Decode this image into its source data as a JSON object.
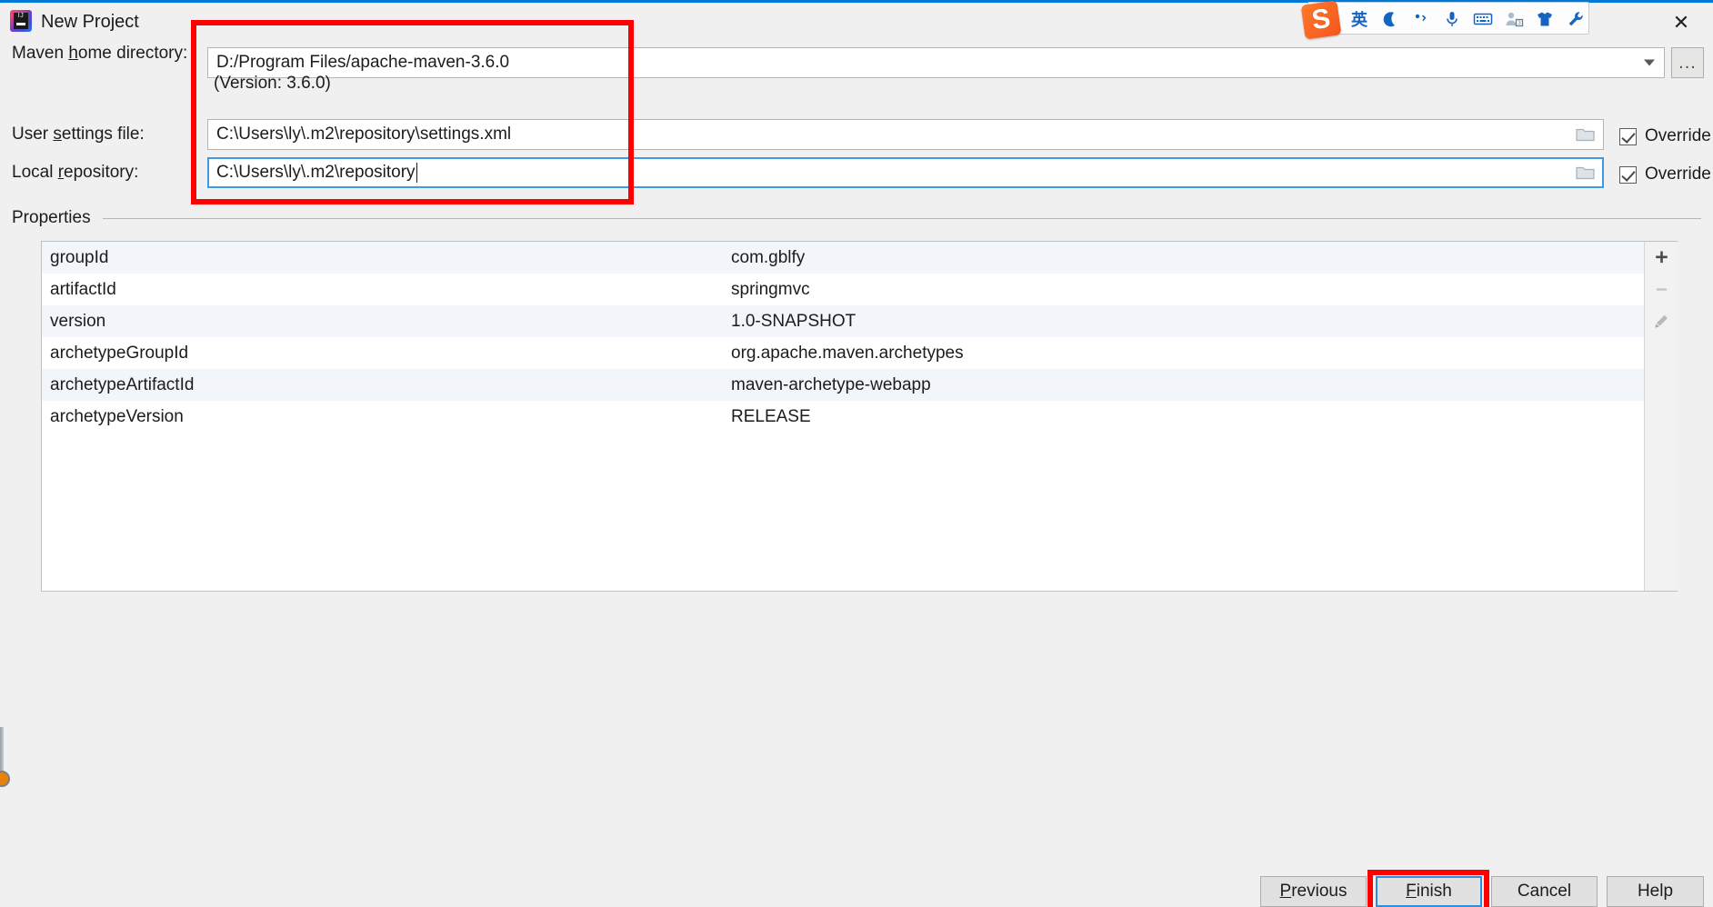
{
  "window": {
    "title": "New Project",
    "logo_icon": "intellij-idea-logo",
    "close_icon": "close-icon",
    "accent_color": "#0078d7"
  },
  "ime_toolbar": {
    "logo": "S",
    "logo_name": "sogou-logo-icon",
    "items": [
      {
        "name": "language-mode-icon",
        "glyph": "英"
      },
      {
        "name": "moon-mode-icon",
        "glyph": "moon"
      },
      {
        "name": "punctuation-mode-icon",
        "glyph": "comma"
      },
      {
        "name": "voice-input-icon",
        "glyph": "microphone"
      },
      {
        "name": "soft-keyboard-icon",
        "glyph": "keyboard"
      },
      {
        "name": "user-account-icon",
        "glyph": "person"
      },
      {
        "name": "skin-theme-icon",
        "glyph": "shirt"
      },
      {
        "name": "toolbox-settings-icon",
        "glyph": "wrench"
      }
    ]
  },
  "form": {
    "maven_home": {
      "label_before": "Maven ",
      "label_mnemonic": "h",
      "label_after": "ome directory:",
      "value": "D:/Program Files/apache-maven-3.6.0",
      "browse_label": "...",
      "version_note": "(Version: 3.6.0)"
    },
    "user_settings": {
      "label_before": "User ",
      "label_mnemonic": "s",
      "label_after": "ettings file:",
      "value": "C:\\Users\\ly\\.m2\\repository\\settings.xml",
      "override_label": "Override",
      "override_checked": true,
      "folder_icon": "folder-browse-icon"
    },
    "local_repository": {
      "label_before": "Local ",
      "label_mnemonic": "r",
      "label_after": "epository:",
      "value": "C:\\Users\\ly\\.m2\\repository",
      "override_label": "Override",
      "override_checked": true,
      "folder_icon": "folder-browse-icon",
      "focused": true
    }
  },
  "properties": {
    "section_label": "Properties",
    "rows": [
      {
        "key": "groupId",
        "value": "com.gblfy"
      },
      {
        "key": "artifactId",
        "value": "springmvc"
      },
      {
        "key": "version",
        "value": "1.0-SNAPSHOT"
      },
      {
        "key": "archetypeGroupId",
        "value": "org.apache.maven.archetypes"
      },
      {
        "key": "archetypeArtifactId",
        "value": "maven-archetype-webapp"
      },
      {
        "key": "archetypeVersion",
        "value": "RELEASE"
      }
    ],
    "actions": [
      {
        "name": "add-property-button",
        "glyph": "+",
        "enabled": true
      },
      {
        "name": "remove-property-button",
        "glyph": "minus",
        "enabled": false
      },
      {
        "name": "edit-property-button",
        "glyph": "pencil",
        "enabled": false
      }
    ]
  },
  "footer": {
    "previous": {
      "before": "",
      "mnemonic": "P",
      "after": "revious"
    },
    "finish": {
      "before": "",
      "mnemonic": "F",
      "after": "inish",
      "focused": true,
      "highlighted": true
    },
    "cancel": {
      "before": "Cancel",
      "mnemonic": "",
      "after": ""
    },
    "help": {
      "before": "Help",
      "mnemonic": "",
      "after": ""
    }
  },
  "annotations": {
    "color": "#ff0000",
    "boxes": [
      {
        "name": "maven-paths-highlight"
      },
      {
        "name": "finish-button-highlight"
      }
    ]
  }
}
